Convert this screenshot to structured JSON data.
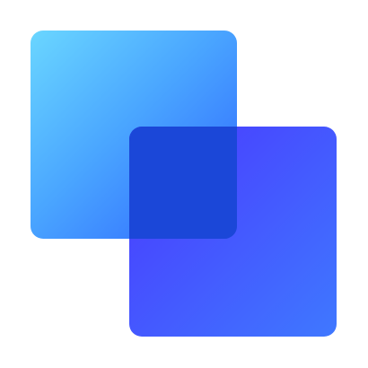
{
  "logo": {
    "icon_name": "overlapping-squares-icon",
    "colors": {
      "back_square_gradient_start": "#6ad6ff",
      "back_square_gradient_mid": "#4aa6ff",
      "back_square_gradient_end": "#2d63ff",
      "front_square_gradient_start": "#4a38ff",
      "front_square_gradient_end": "#3f78ff",
      "overlap": "#1b47d8",
      "background": "#ffffff"
    }
  }
}
